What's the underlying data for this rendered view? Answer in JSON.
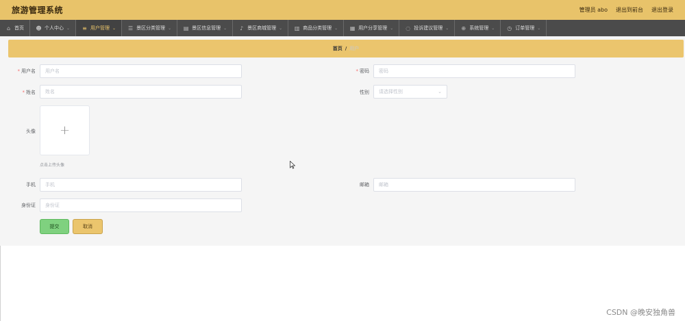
{
  "header": {
    "title": "旅游管理系统",
    "user_label": "管理员 abo",
    "backend_label": "退出到前台",
    "logout_label": "退出登录"
  },
  "nav": {
    "items": [
      {
        "label": "首页",
        "icon": "home-icon",
        "glyph": "⌂"
      },
      {
        "label": "个人中心",
        "icon": "user-icon",
        "glyph": "☻"
      },
      {
        "label": "用户管理",
        "icon": "list-icon",
        "glyph": "≡"
      },
      {
        "label": "景区分类管理",
        "icon": "menu-icon",
        "glyph": "☰"
      },
      {
        "label": "景区信息管理",
        "icon": "chart-icon",
        "glyph": "▤"
      },
      {
        "label": "景区商城管理",
        "icon": "mic-icon",
        "glyph": "♪"
      },
      {
        "label": "商品分类管理",
        "icon": "trash-icon",
        "glyph": "▥"
      },
      {
        "label": "用户分享管理",
        "icon": "briefcase-icon",
        "glyph": "▦"
      },
      {
        "label": "投诉建议管理",
        "icon": "refresh-icon",
        "glyph": "◌"
      },
      {
        "label": "系统管理",
        "icon": "plus-circle-icon",
        "glyph": "⊕"
      },
      {
        "label": "订单管理",
        "icon": "clock-icon",
        "glyph": "◷"
      }
    ],
    "active_index": 2
  },
  "breadcrumb": {
    "home": "首页",
    "separator": "/",
    "current": "用户"
  },
  "form": {
    "username": {
      "label": "用户名",
      "placeholder": "用户名",
      "required": true
    },
    "password": {
      "label": "密码",
      "placeholder": "密码",
      "required": true
    },
    "name": {
      "label": "姓名",
      "placeholder": "姓名",
      "required": true
    },
    "gender": {
      "label": "性别",
      "placeholder": "请选择性别"
    },
    "avatar": {
      "label": "头像",
      "tip": "点击上传头像"
    },
    "phone": {
      "label": "手机",
      "placeholder": "手机"
    },
    "email": {
      "label": "邮箱",
      "placeholder": "邮箱"
    },
    "id_card": {
      "label": "身份证",
      "placeholder": "身份证"
    },
    "submit_label": "提交",
    "cancel_label": "取消"
  },
  "watermark": "CSDN @晚安独角兽",
  "colors": {
    "header_bg": "#e8c36a",
    "nav_bg": "#4b4b4b",
    "active_nav_text": "#e8c36a",
    "submit_bg": "#7fd17f",
    "cancel_bg": "#ebc56d",
    "required": "#f56c6c"
  }
}
